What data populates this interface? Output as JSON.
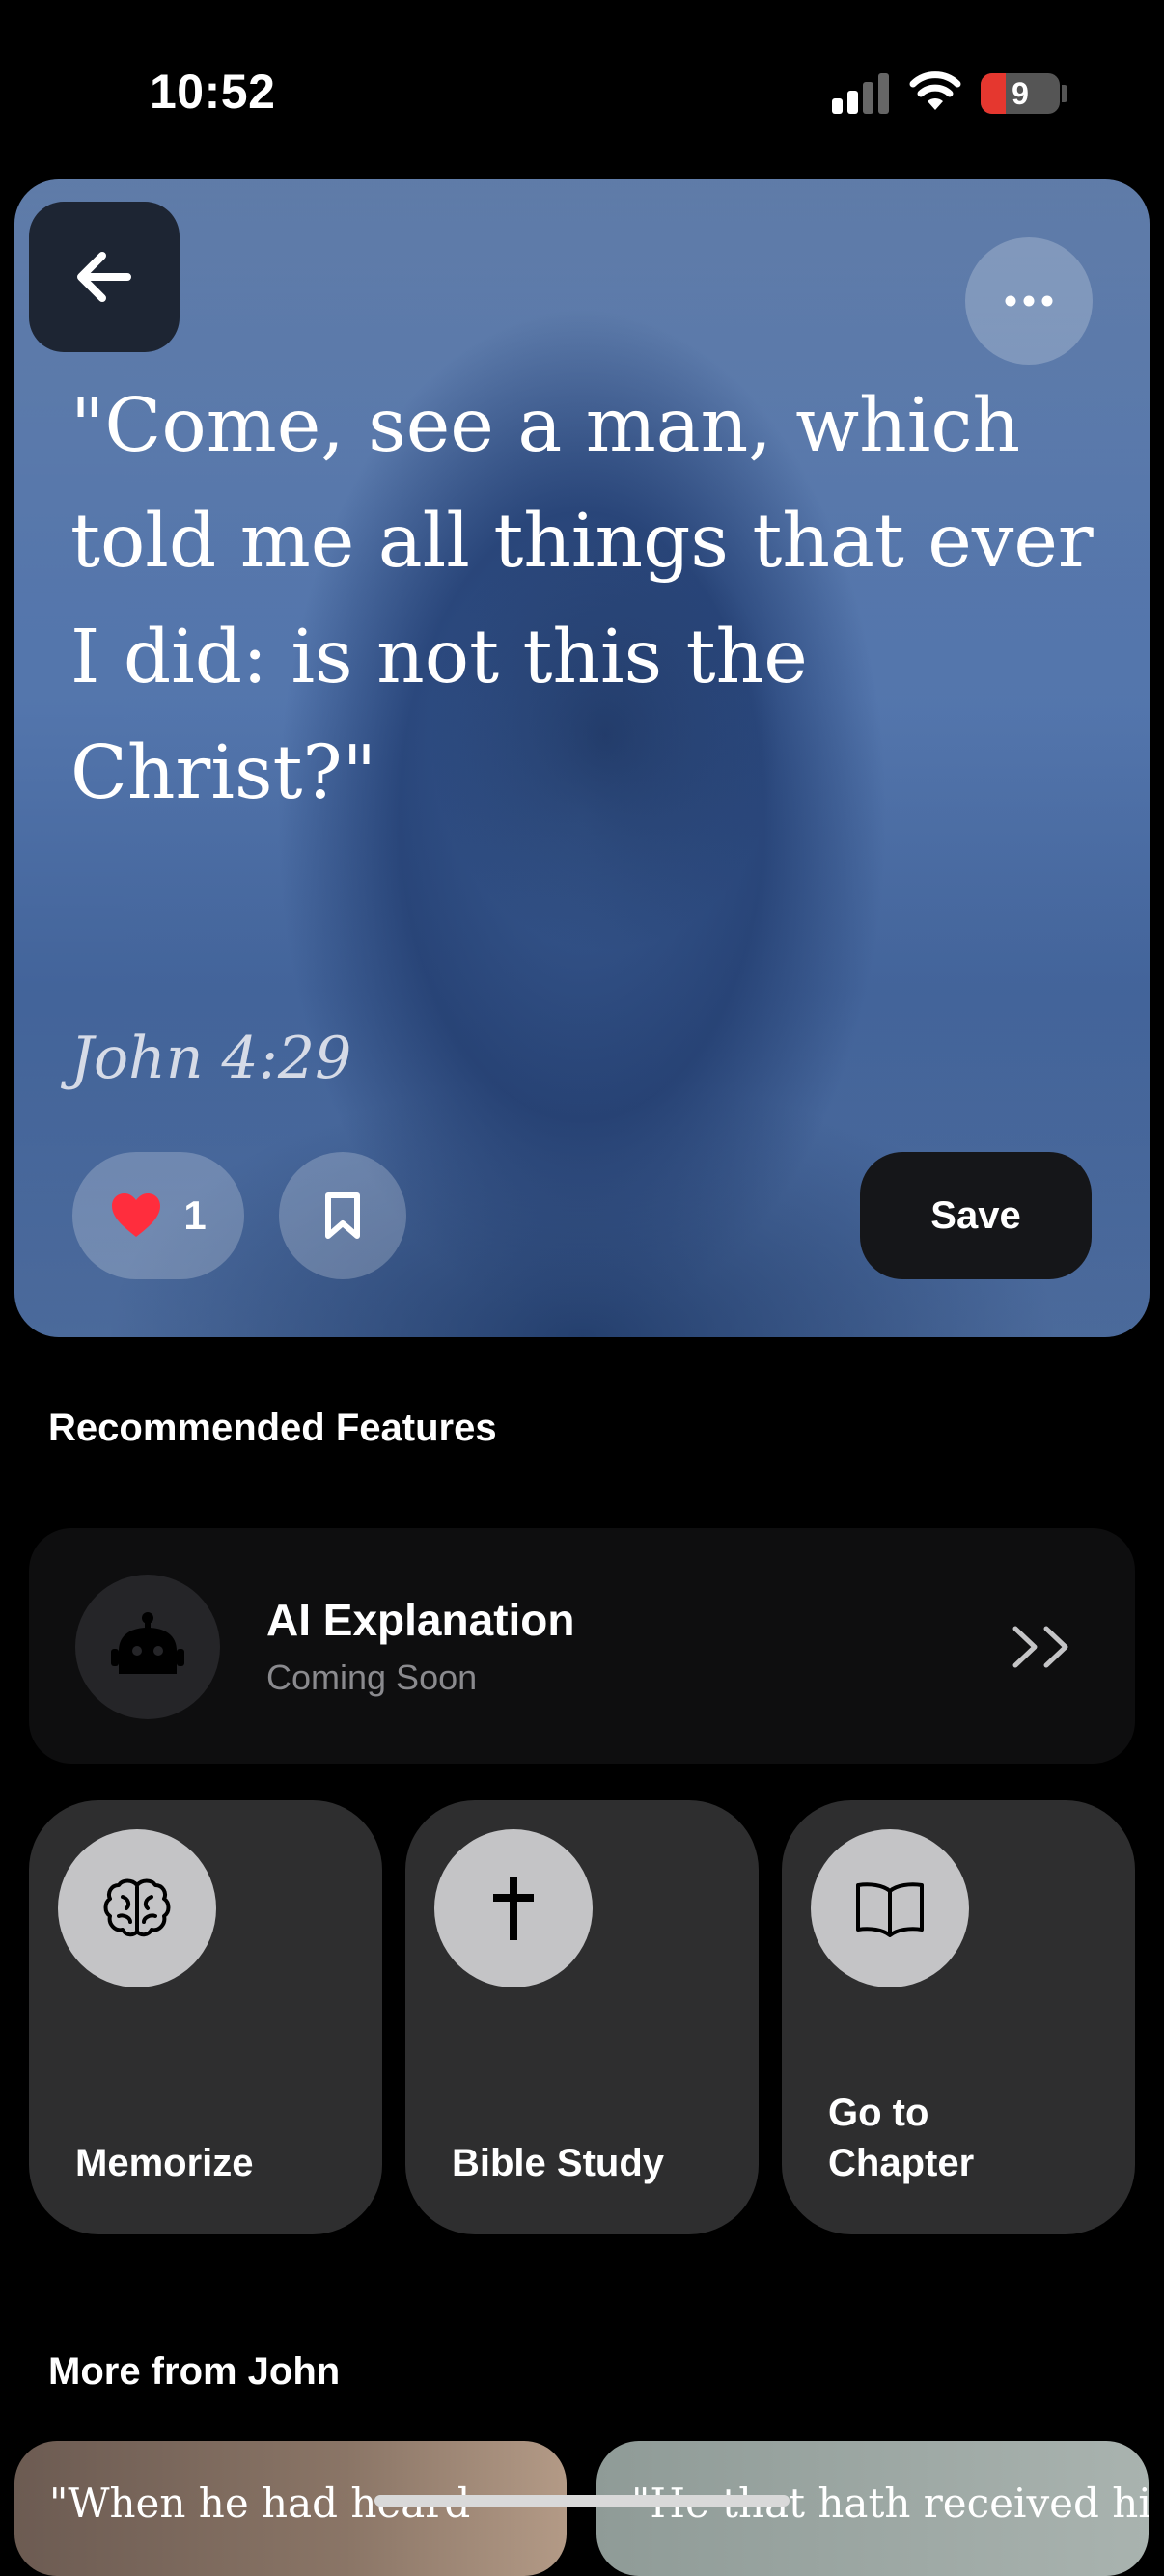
{
  "status_bar": {
    "time": "10:52",
    "battery": "9"
  },
  "hero": {
    "verse": "\"Come, see a man, which told me all things that ever I did: is not this the Christ?\"",
    "reference": "John 4:29",
    "like_count": "1",
    "save_label": "Save"
  },
  "recommended": {
    "title": "Recommended Features",
    "ai": {
      "title": "AI Explanation",
      "subtitle": "Coming Soon"
    },
    "features": [
      {
        "label": "Memorize",
        "icon": "brain-icon"
      },
      {
        "label": "Bible Study",
        "icon": "cross-icon"
      },
      {
        "label": "Go to Chapter",
        "icon": "book-icon"
      }
    ]
  },
  "more": {
    "title": "More from John",
    "cards": [
      {
        "text": "\"When he had heard"
      },
      {
        "text": "\"He that hath received his"
      }
    ]
  },
  "colors": {
    "background": "#000000",
    "card": "#2e2e2f",
    "heart": "#ff2d3d",
    "hero_blue": "#4a6ea8"
  }
}
